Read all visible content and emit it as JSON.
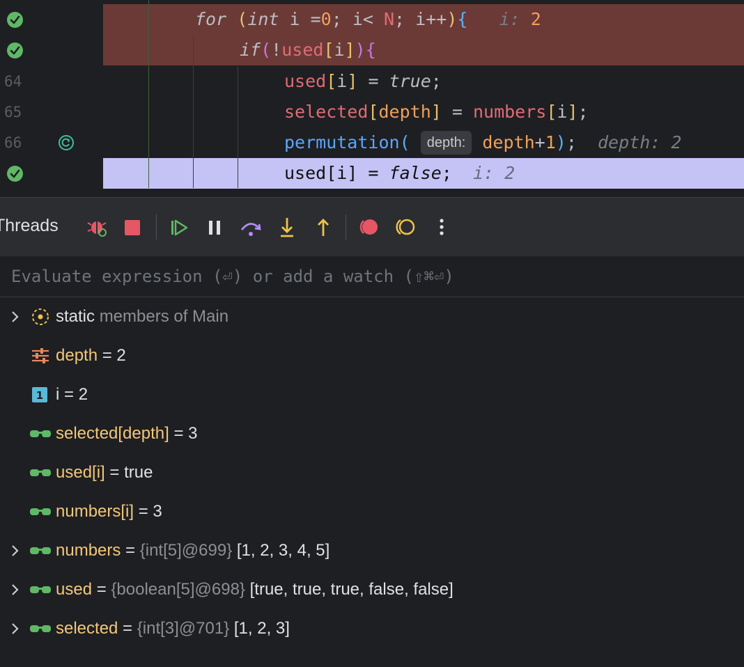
{
  "editor": {
    "lines": [
      {
        "num": "",
        "marker": "check",
        "highlight": "red",
        "hint_label": "i:",
        "hint_value": "2"
      },
      {
        "num": "",
        "marker": "check",
        "highlight": "red"
      },
      {
        "num": "64",
        "marker": ""
      },
      {
        "num": "65",
        "marker": ""
      },
      {
        "num": "66",
        "marker": "rerun",
        "inlay": "depth:",
        "hint_label": "depth:",
        "hint_value": "2"
      },
      {
        "num": "",
        "marker": "check",
        "highlight": "blue",
        "hint_label": "i:",
        "hint_value": "2"
      }
    ]
  },
  "toolbar": {
    "label": "Threads",
    "buttons": [
      "rerun-debug-icon",
      "stop-icon",
      "resume-icon",
      "pause-icon",
      "step-over-icon",
      "step-into-icon",
      "step-out-icon",
      "view-breakpoints-icon",
      "mute-breakpoints-icon",
      "more-options-icon"
    ]
  },
  "evaluate": {
    "placeholder": "Evaluate expression (⏎) or add a watch (⇧⌘⏎)"
  },
  "variables": [
    {
      "expandable": true,
      "icon": "static-members-icon",
      "name": "static",
      "eq": "",
      "type": "members of Main",
      "value": ""
    },
    {
      "expandable": false,
      "icon": "parameter-icon",
      "name": "depth",
      "eq": " = ",
      "type": "",
      "value": "2"
    },
    {
      "expandable": false,
      "icon": "primitive-int-icon",
      "name": "i",
      "eq": " = ",
      "type": "",
      "value": "2"
    },
    {
      "expandable": false,
      "icon": "watch-glasses-icon",
      "name": "selected[depth]",
      "eq": " = ",
      "type": "",
      "value": "3"
    },
    {
      "expandable": false,
      "icon": "watch-glasses-icon",
      "name": "used[i]",
      "eq": " = ",
      "type": "",
      "value": "true"
    },
    {
      "expandable": false,
      "icon": "watch-glasses-icon",
      "name": "numbers[i]",
      "eq": " = ",
      "type": "",
      "value": "3"
    },
    {
      "expandable": true,
      "icon": "watch-glasses-icon",
      "name": "numbers",
      "eq": " = ",
      "type": "{int[5]@699} ",
      "value": "[1, 2, 3, 4, 5]"
    },
    {
      "expandable": true,
      "icon": "watch-glasses-icon",
      "name": "used",
      "eq": " = ",
      "type": "{boolean[5]@698} ",
      "value": "[true, true, true, false, false]"
    },
    {
      "expandable": true,
      "icon": "watch-glasses-icon",
      "name": "selected",
      "eq": " = ",
      "type": "{int[3]@701} ",
      "value": "[1, 2, 3]"
    }
  ],
  "colors": {
    "highlight_red": "#6b3a37",
    "highlight_blue": "#c5c3f5",
    "check_green": "#5fb865",
    "name_yellow": "#f3c77a"
  }
}
